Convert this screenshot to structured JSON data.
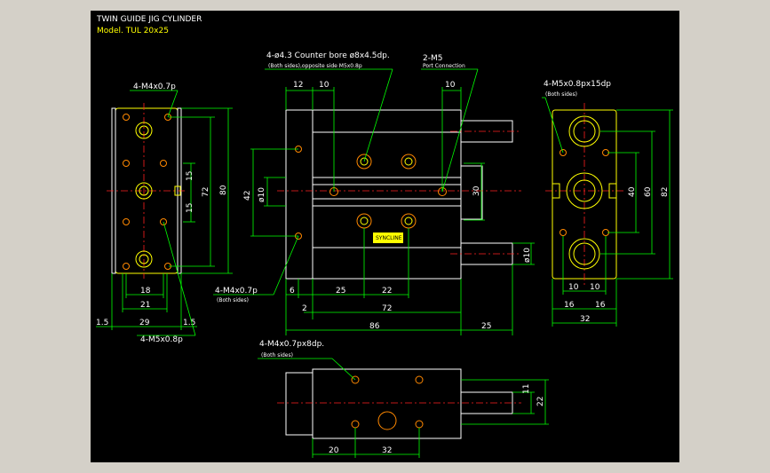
{
  "drawing": {
    "title": "TWIN GUIDE JIG CYLINDER",
    "model": "Model. TUL 20x25"
  },
  "notes": {
    "left_top_tap": "4-M4x0.7p",
    "left_bottom_tap": "4-M4x0.7p",
    "left_bottom_tap_sub": "(Both sides)",
    "left_bottom_m5": "4-M5x0.8p",
    "counterbore": "4-ø4.3  Counter bore ø8x4.5dp.",
    "counterbore_sub": "(Both sides),opposite side M5x0.8p",
    "port": "2-M5",
    "port_sub": "Port Connection",
    "right_tap": "4-M5x0.8px15dp",
    "right_tap_sub": "(Both sides)",
    "bottom_tap": "4-M4x0.7px8dp.",
    "bottom_tap_sub": "(Both sides)",
    "brand": "SYNCLINE"
  },
  "dims": {
    "left": {
      "d15a": "15",
      "d15b": "15",
      "d72": "72",
      "d80": "80",
      "d18": "18",
      "d21": "21",
      "d29": "29",
      "d15l": "1.5",
      "d15r": "1.5"
    },
    "front": {
      "d12": "12",
      "d10a": "10",
      "d10b": "10",
      "d42": "42",
      "dphi10": "ø10",
      "d30": "30",
      "dphi10b": "ø10",
      "d6": "6",
      "d25": "25",
      "d22": "22",
      "d2": "2",
      "d72": "72",
      "d86": "86",
      "d25b": "25"
    },
    "right": {
      "d40": "40",
      "d60": "60",
      "d82": "82",
      "d10a": "10",
      "d10b": "10",
      "d16a": "16",
      "d16b": "16",
      "d32": "32"
    },
    "bottom": {
      "d11": "11",
      "d22": "22",
      "d20": "20",
      "d32": "32"
    }
  },
  "colors": {
    "background": "#000000",
    "outline": "#ffffff",
    "dimension": "#00ff00",
    "centerline": "#ff2020",
    "highlight": "#ffff00",
    "frame": "#d4d0c8"
  }
}
